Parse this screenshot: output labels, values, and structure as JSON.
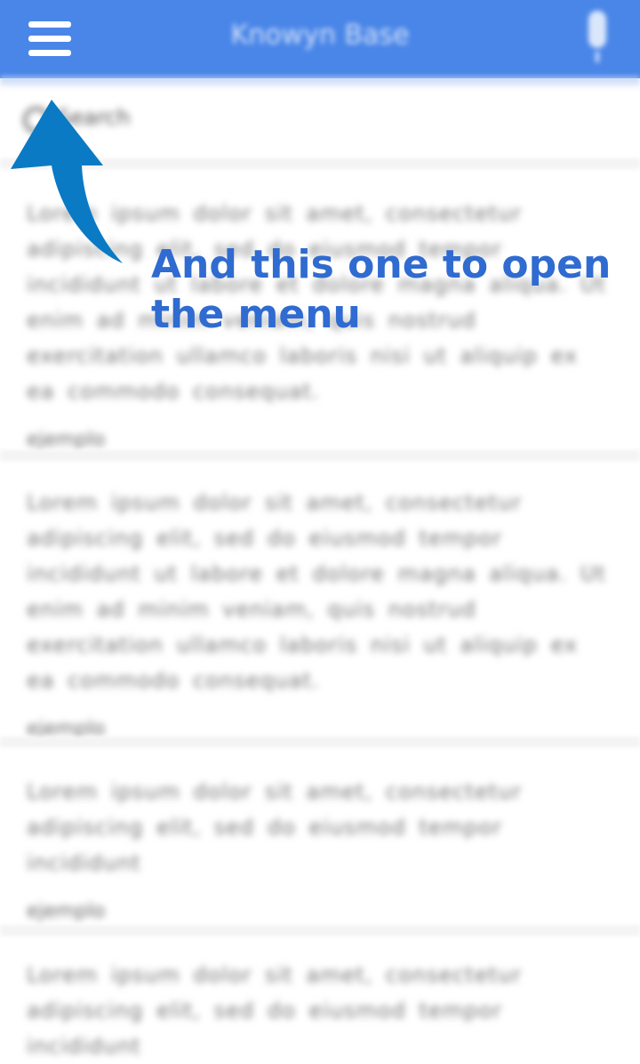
{
  "appbar": {
    "title": "Knowyn Base",
    "menu_icon": "hamburger-menu-icon",
    "mic_icon": "microphone-icon",
    "color": "#4a86e8"
  },
  "search": {
    "placeholder": "Search"
  },
  "posts": [
    {
      "text": "Lorem ipsum dolor sit amet, consectetur adipiscing elit, sed do eiusmod tempor incididunt ut labore et dolore magna aliqua. Ut enim ad minim veniam, quis nostrud exercitation ullamco laboris nisi ut aliquip ex ea commodo consequat.",
      "tag": "ejemplo"
    },
    {
      "text": "Lorem ipsum dolor sit amet, consectetur adipiscing elit, sed do eiusmod tempor incididunt ut labore et dolore magna aliqua. Ut enim ad minim veniam, quis nostrud exercitation ullamco laboris nisi ut aliquip ex ea commodo consequat.",
      "tag": "ejemplo"
    },
    {
      "text": "Lorem ipsum dolor sit amet, consectetur adipiscing elit, sed do eiusmod tempor incididunt",
      "tag": "ejemplo"
    },
    {
      "text": "Lorem ipsum dolor sit amet, consectetur adipiscing elit, sed do eiusmod tempor incididunt",
      "tag": ""
    }
  ],
  "annotation": {
    "text": "And this one to open the menu",
    "color": "#2f6bd0",
    "arrow_color": "#0a7ac4"
  }
}
